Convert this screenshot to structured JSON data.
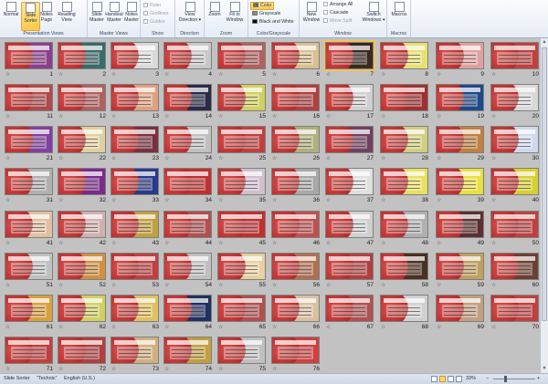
{
  "ribbon": {
    "groups": {
      "presentation_views": {
        "label": "Presentation Views",
        "buttons": [
          {
            "label": "Normal",
            "selected": false
          },
          {
            "label": "Slide Sorter",
            "selected": true
          },
          {
            "label": "Notes Page",
            "selected": false
          },
          {
            "label": "Reading View",
            "selected": false
          }
        ]
      },
      "master_views": {
        "label": "Master Views",
        "buttons": [
          {
            "label": "Slide Master"
          },
          {
            "label": "Handout Master"
          },
          {
            "label": "Notes Master"
          }
        ]
      },
      "show": {
        "label": "Show",
        "items": [
          "Ruler",
          "Gridlines",
          "Guides"
        ]
      },
      "direction": {
        "label": "Direction",
        "button": "View Direction ▾"
      },
      "zoom": {
        "label": "Zoom",
        "buttons": [
          "Zoom",
          "Fit to Window"
        ]
      },
      "color_grayscale": {
        "label": "Color/Grayscale",
        "items": [
          "Color",
          "Grayscale",
          "Black and White"
        ]
      },
      "window": {
        "label": "Window",
        "new_window": "New Window",
        "items": [
          "Arrange All",
          "Cascade",
          "Move Split"
        ],
        "switch": "Switch Windows ▾"
      },
      "macros": {
        "label": "Macros",
        "button": "Macros"
      }
    }
  },
  "sorter": {
    "selected_slide": 7,
    "star_glyph": "☆",
    "slides": [
      "#8b3f8d",
      "#3a6a6a",
      "#d9d9d9",
      "#c8c8c8",
      "#b06060",
      "#d8c090",
      "#3a2a20",
      "#e8e070",
      "#e0a0a0",
      "#c04040",
      "#b04a4a",
      "#b06060",
      "#e0a080",
      "#2a2a4a",
      "#d0d060",
      "#b04040",
      "#d0d0d0",
      "#a03030",
      "#1c4a8a",
      "#d8d8d8",
      "#8040a0",
      "#e0d0a0",
      "#7a3040",
      "#c0c0c0",
      "#c04040",
      "#b0b080",
      "#704060",
      "#d0d080",
      "#c08040",
      "#d0d8f0",
      "#b0b0b0",
      "#7a2a8a",
      "#2a3a8a",
      "#c03030",
      "#d0c0d0",
      "#a8a8a8",
      "#e0e0e0",
      "#e8e060",
      "#e8e040",
      "#d8d030",
      "#e0c0a0",
      "#d0b0b0",
      "#c0a040",
      "#b05050",
      "#c03030",
      "#c05050",
      "#d0d0d0",
      "#b0b0b0",
      "#5a3030",
      "#c04040",
      "#c0c0c0",
      "#d09040",
      "#c04040",
      "#c0c0c0",
      "#e8d0a0",
      "#b07050",
      "#b04040",
      "#4a3020",
      "#c0a060",
      "#6a4030",
      "#d8a040",
      "#d0d060",
      "#e0c060",
      "#203060",
      "#b05050",
      "#d8c0a0",
      "#b05050",
      "#d0d0d0",
      "#c0a080",
      "#c04040",
      "#c04040",
      "#b04040",
      "#d0b080",
      "#c0a040",
      "#c0c0c0",
      "#d04040"
    ]
  },
  "status": {
    "view": "Slide Sorter",
    "theme": "\"Technic\"",
    "language": "English (U.S.)",
    "zoom": "33%",
    "minus": "−",
    "plus": "+"
  }
}
